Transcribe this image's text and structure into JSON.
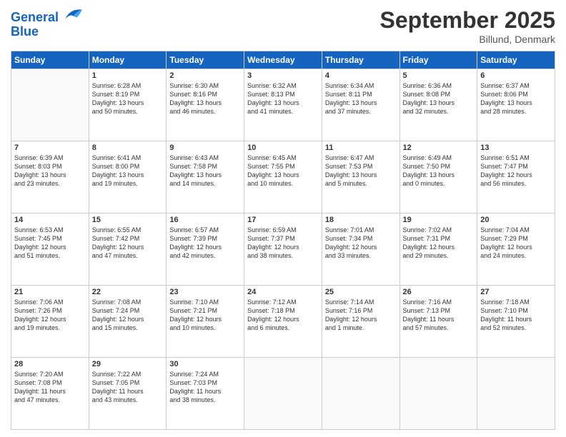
{
  "header": {
    "logo_line1": "General",
    "logo_line2": "Blue",
    "title": "September 2025",
    "subtitle": "Billund, Denmark"
  },
  "weekdays": [
    "Sunday",
    "Monday",
    "Tuesday",
    "Wednesday",
    "Thursday",
    "Friday",
    "Saturday"
  ],
  "weeks": [
    [
      {
        "day": "",
        "info": ""
      },
      {
        "day": "1",
        "info": "Sunrise: 6:28 AM\nSunset: 8:19 PM\nDaylight: 13 hours\nand 50 minutes."
      },
      {
        "day": "2",
        "info": "Sunrise: 6:30 AM\nSunset: 8:16 PM\nDaylight: 13 hours\nand 46 minutes."
      },
      {
        "day": "3",
        "info": "Sunrise: 6:32 AM\nSunset: 8:13 PM\nDaylight: 13 hours\nand 41 minutes."
      },
      {
        "day": "4",
        "info": "Sunrise: 6:34 AM\nSunset: 8:11 PM\nDaylight: 13 hours\nand 37 minutes."
      },
      {
        "day": "5",
        "info": "Sunrise: 6:36 AM\nSunset: 8:08 PM\nDaylight: 13 hours\nand 32 minutes."
      },
      {
        "day": "6",
        "info": "Sunrise: 6:37 AM\nSunset: 8:06 PM\nDaylight: 13 hours\nand 28 minutes."
      }
    ],
    [
      {
        "day": "7",
        "info": "Sunrise: 6:39 AM\nSunset: 8:03 PM\nDaylight: 13 hours\nand 23 minutes."
      },
      {
        "day": "8",
        "info": "Sunrise: 6:41 AM\nSunset: 8:00 PM\nDaylight: 13 hours\nand 19 minutes."
      },
      {
        "day": "9",
        "info": "Sunrise: 6:43 AM\nSunset: 7:58 PM\nDaylight: 13 hours\nand 14 minutes."
      },
      {
        "day": "10",
        "info": "Sunrise: 6:45 AM\nSunset: 7:55 PM\nDaylight: 13 hours\nand 10 minutes."
      },
      {
        "day": "11",
        "info": "Sunrise: 6:47 AM\nSunset: 7:53 PM\nDaylight: 13 hours\nand 5 minutes."
      },
      {
        "day": "12",
        "info": "Sunrise: 6:49 AM\nSunset: 7:50 PM\nDaylight: 13 hours\nand 0 minutes."
      },
      {
        "day": "13",
        "info": "Sunrise: 6:51 AM\nSunset: 7:47 PM\nDaylight: 12 hours\nand 56 minutes."
      }
    ],
    [
      {
        "day": "14",
        "info": "Sunrise: 6:53 AM\nSunset: 7:45 PM\nDaylight: 12 hours\nand 51 minutes."
      },
      {
        "day": "15",
        "info": "Sunrise: 6:55 AM\nSunset: 7:42 PM\nDaylight: 12 hours\nand 47 minutes."
      },
      {
        "day": "16",
        "info": "Sunrise: 6:57 AM\nSunset: 7:39 PM\nDaylight: 12 hours\nand 42 minutes."
      },
      {
        "day": "17",
        "info": "Sunrise: 6:59 AM\nSunset: 7:37 PM\nDaylight: 12 hours\nand 38 minutes."
      },
      {
        "day": "18",
        "info": "Sunrise: 7:01 AM\nSunset: 7:34 PM\nDaylight: 12 hours\nand 33 minutes."
      },
      {
        "day": "19",
        "info": "Sunrise: 7:02 AM\nSunset: 7:31 PM\nDaylight: 12 hours\nand 29 minutes."
      },
      {
        "day": "20",
        "info": "Sunrise: 7:04 AM\nSunset: 7:29 PM\nDaylight: 12 hours\nand 24 minutes."
      }
    ],
    [
      {
        "day": "21",
        "info": "Sunrise: 7:06 AM\nSunset: 7:26 PM\nDaylight: 12 hours\nand 19 minutes."
      },
      {
        "day": "22",
        "info": "Sunrise: 7:08 AM\nSunset: 7:24 PM\nDaylight: 12 hours\nand 15 minutes."
      },
      {
        "day": "23",
        "info": "Sunrise: 7:10 AM\nSunset: 7:21 PM\nDaylight: 12 hours\nand 10 minutes."
      },
      {
        "day": "24",
        "info": "Sunrise: 7:12 AM\nSunset: 7:18 PM\nDaylight: 12 hours\nand 6 minutes."
      },
      {
        "day": "25",
        "info": "Sunrise: 7:14 AM\nSunset: 7:16 PM\nDaylight: 12 hours\nand 1 minute."
      },
      {
        "day": "26",
        "info": "Sunrise: 7:16 AM\nSunset: 7:13 PM\nDaylight: 11 hours\nand 57 minutes."
      },
      {
        "day": "27",
        "info": "Sunrise: 7:18 AM\nSunset: 7:10 PM\nDaylight: 11 hours\nand 52 minutes."
      }
    ],
    [
      {
        "day": "28",
        "info": "Sunrise: 7:20 AM\nSunset: 7:08 PM\nDaylight: 11 hours\nand 47 minutes."
      },
      {
        "day": "29",
        "info": "Sunrise: 7:22 AM\nSunset: 7:05 PM\nDaylight: 11 hours\nand 43 minutes."
      },
      {
        "day": "30",
        "info": "Sunrise: 7:24 AM\nSunset: 7:03 PM\nDaylight: 11 hours\nand 38 minutes."
      },
      {
        "day": "",
        "info": ""
      },
      {
        "day": "",
        "info": ""
      },
      {
        "day": "",
        "info": ""
      },
      {
        "day": "",
        "info": ""
      }
    ]
  ]
}
